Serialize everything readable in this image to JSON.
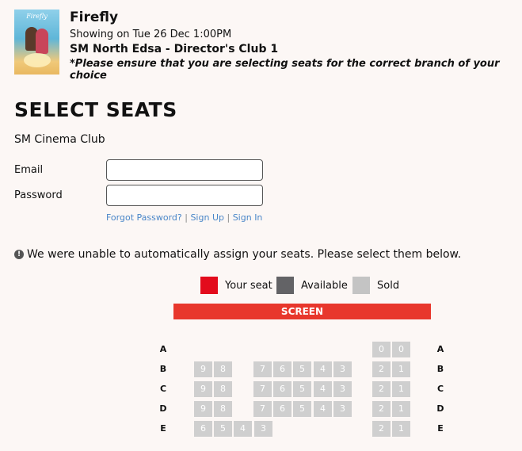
{
  "movie": {
    "poster_title": "Firefly",
    "title": "Firefly",
    "showing": "Showing on Tue 26 Dec 1:00PM",
    "branch": "SM North Edsa - Director's Club 1",
    "warning": "*Please ensure that you are selecting seats for the correct branch of your choice"
  },
  "section_title": "SELECT SEATS",
  "login": {
    "club_label": "SM Cinema Club",
    "email_label": "Email",
    "email_value": "",
    "password_label": "Password",
    "password_value": "",
    "forgot_password": "Forgot Password?",
    "sign_up": "Sign Up",
    "sign_in": "Sign In",
    "separator": "|"
  },
  "notice": {
    "icon": "exclamation-circle-icon",
    "text": "We were unable to automatically assign your seats. Please select them below."
  },
  "legend": [
    {
      "label": "Your seat",
      "color": "#e30b1c"
    },
    {
      "label": "Available",
      "color": "#636366"
    },
    {
      "label": "Sold",
      "color": "#c4c4c4"
    }
  ],
  "screen_label": "SCREEN",
  "seat_map": {
    "status": "sold",
    "rows": [
      {
        "row": "A",
        "left_block": [],
        "middle_block": [],
        "right_block": [
          "0",
          "0"
        ]
      },
      {
        "row": "B",
        "left_block": [
          "9",
          "8"
        ],
        "middle_block": [
          "7",
          "6",
          "5",
          "4",
          "3"
        ],
        "right_block": [
          "2",
          "1"
        ]
      },
      {
        "row": "C",
        "left_block": [
          "9",
          "8"
        ],
        "middle_block": [
          "7",
          "6",
          "5",
          "4",
          "3"
        ],
        "right_block": [
          "2",
          "1"
        ]
      },
      {
        "row": "D",
        "left_block": [
          "9",
          "8"
        ],
        "middle_block": [
          "7",
          "6",
          "5",
          "4",
          "3"
        ],
        "right_block": [
          "2",
          "1"
        ]
      },
      {
        "row": "E",
        "left_block": [
          "6",
          "5",
          "4",
          "3"
        ],
        "middle_block": [],
        "right_block": [
          "2",
          "1"
        ]
      }
    ]
  }
}
